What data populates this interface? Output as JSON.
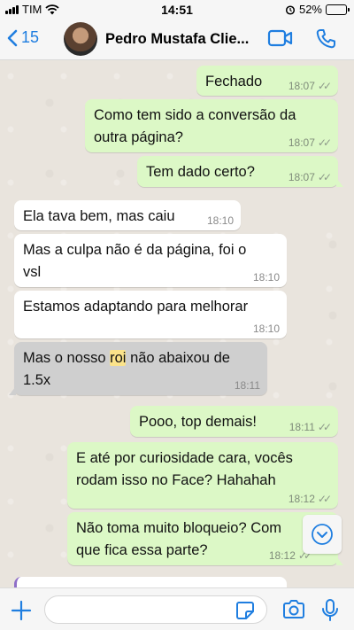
{
  "status_bar": {
    "carrier": "TIM",
    "time": "14:51",
    "battery": "52%",
    "battery_level": 0.52
  },
  "header": {
    "back_count": "15",
    "contact_name": "Pedro Mustafa Clie..."
  },
  "messages": [
    {
      "dir": "out",
      "text": "Fechado",
      "time": "18:07"
    },
    {
      "dir": "out",
      "text": "Como tem sido a conversão da outra página?",
      "line1": "Como tem sido a conversão da",
      "line2": "outra página?",
      "time": "18:07"
    },
    {
      "dir": "out",
      "text": "Tem dado certo?",
      "time": "18:07"
    },
    {
      "dir": "in",
      "text": "Ela tava bem, mas caiu",
      "time": "18:10"
    },
    {
      "dir": "in",
      "text": "Mas a culpa não é da página, foi o vsl",
      "line1": "Mas a culpa não é da página, foi o",
      "line2": "vsl",
      "time": "18:10"
    },
    {
      "dir": "in",
      "text": "Estamos adaptando para melhorar",
      "time": "18:10"
    },
    {
      "dir": "in",
      "text": "Mas o nosso roi não abaixou de 1.5x",
      "pre": "Mas o nosso ",
      "highlight": "roi",
      "post": " não abaixou de",
      "line2": "1.5x",
      "time": "18:11"
    },
    {
      "dir": "out",
      "text": "Pooo, top demais!",
      "time": "18:11"
    },
    {
      "dir": "out",
      "text": "E até por curiosidade cara, vocês rodam isso no Face? Hahahah",
      "line1": "E até por curiosidade cara, vocês",
      "line2": "rodam isso no Face? Hahahah",
      "time": "18:12"
    },
    {
      "dir": "out",
      "text": "Não toma muito bloqueio? Como que fica essa parte?",
      "line1": "Não toma muito bloqueio? Com",
      "line2": "que fica essa parte?",
      "time": "18:12"
    }
  ],
  "input": {
    "placeholder": ""
  },
  "icons": {
    "back": "chevron-left-icon",
    "video": "video-camera-icon",
    "call": "phone-icon",
    "plus": "plus-icon",
    "sticker": "sticker-icon",
    "camera": "camera-icon",
    "mic": "microphone-icon",
    "scroll": "chevron-down-icon",
    "alarm": "alarm-icon",
    "wifi": "wifi-icon"
  },
  "colors": {
    "accent": "#1f7ee0",
    "outgoing": "#dcf8c6",
    "incoming": "#ffffff",
    "selected": "#cfcfcf",
    "highlight": "#fbe38a"
  }
}
